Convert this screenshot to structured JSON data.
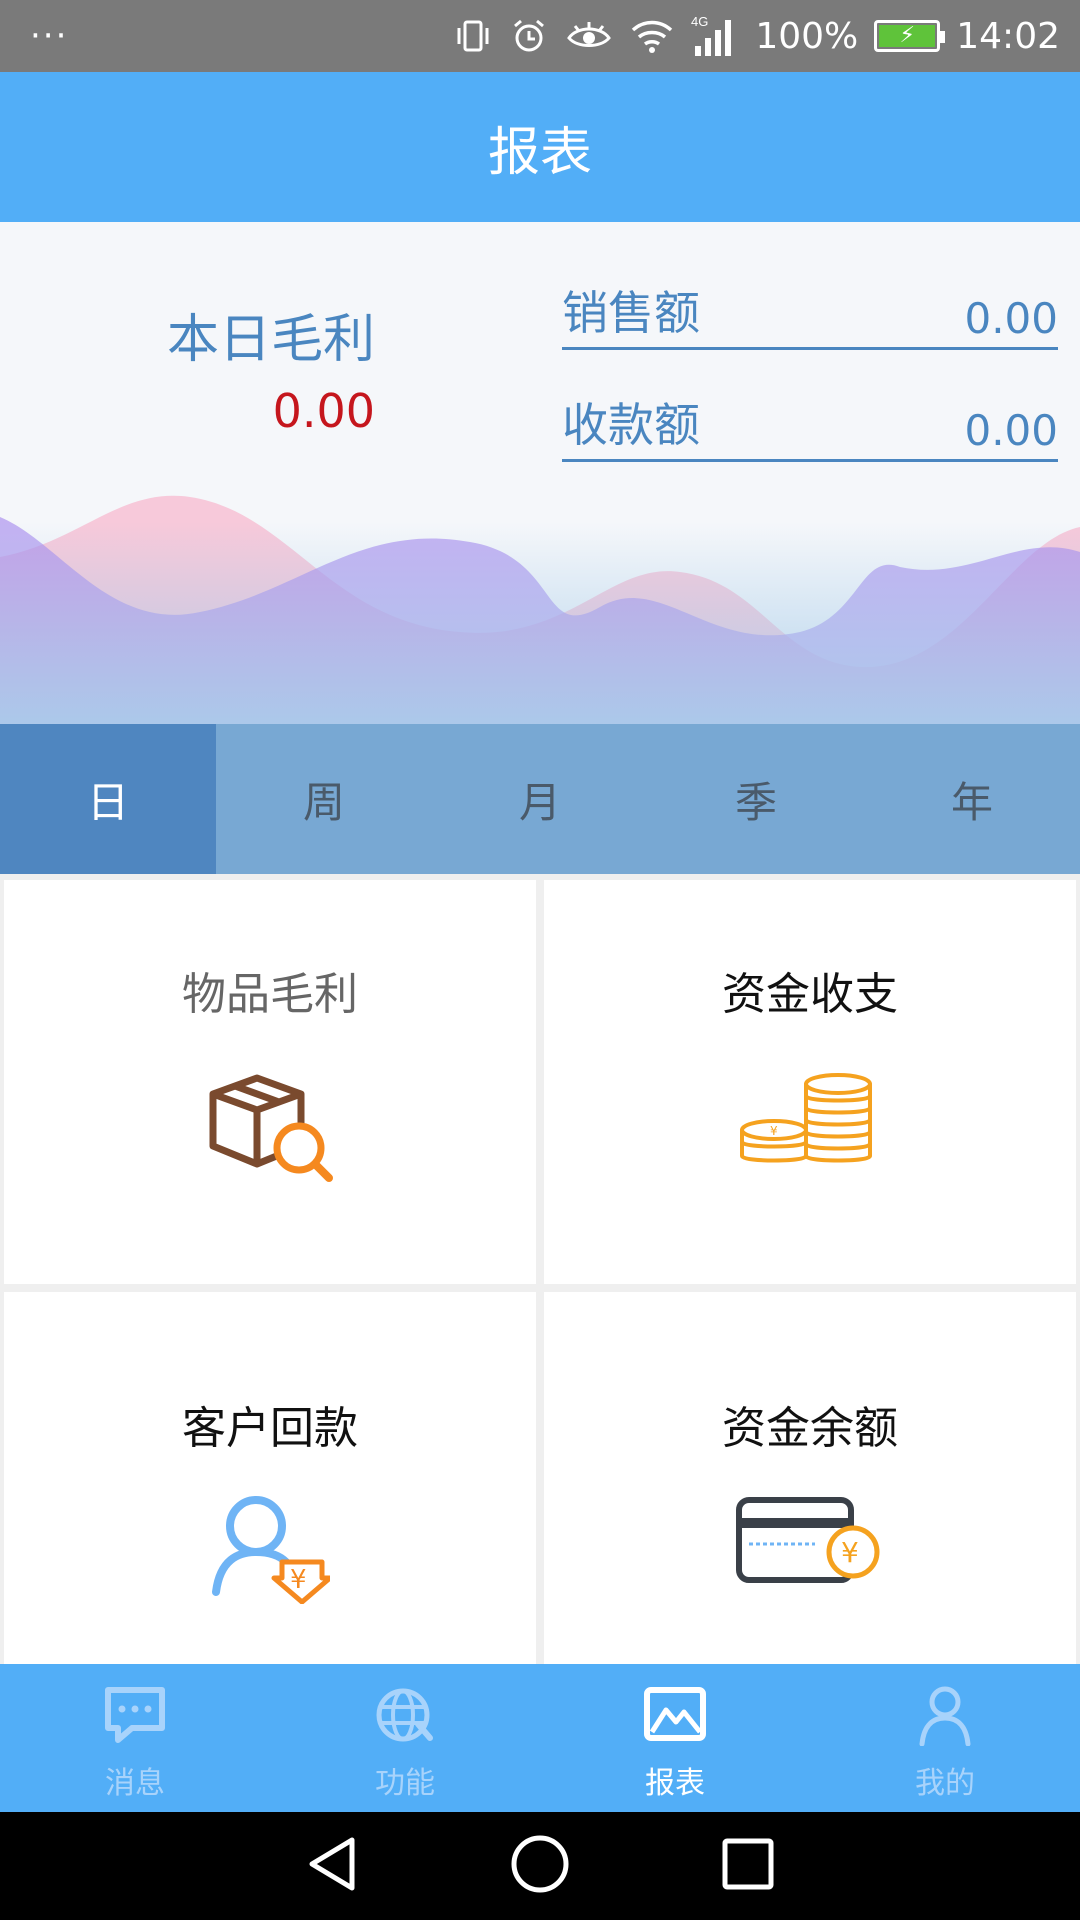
{
  "status_bar": {
    "menu_dots": "···",
    "network": "4G",
    "battery_text": "100%",
    "time": "14:02",
    "battery_color": "#5fc33a",
    "icons": [
      "vibrate-icon",
      "alarm-icon",
      "eye-icon",
      "wifi-icon",
      "signal-icon",
      "battery-icon"
    ]
  },
  "header": {
    "title": "报表",
    "bg_color": "#52aef7"
  },
  "summary": {
    "day_profit_label": "本日毛利",
    "day_profit_value": "0.00",
    "sales_label": "销售额",
    "sales_value": "0.00",
    "receipts_label": "收款额",
    "receipts_value": "0.00",
    "profit_value_color": "#c5161d",
    "label_color": "#4a86c0"
  },
  "period_tabs": {
    "items": [
      "日",
      "周",
      "月",
      "季",
      "年"
    ],
    "active_index": 0
  },
  "report_cards": [
    {
      "label": "物品毛利",
      "icon": "box-search-icon"
    },
    {
      "label": "资金收支",
      "icon": "coins-icon"
    },
    {
      "label": "客户回款",
      "icon": "user-return-icon"
    },
    {
      "label": "资金余额",
      "icon": "card-balance-icon"
    }
  ],
  "bottom_nav": {
    "items": [
      {
        "label": "消息",
        "icon": "message-icon"
      },
      {
        "label": "功能",
        "icon": "globe-icon"
      },
      {
        "label": "报表",
        "icon": "image-chart-icon"
      },
      {
        "label": "我的",
        "icon": "person-icon"
      }
    ],
    "active_index": 2
  },
  "system_nav": {
    "icons": [
      "back-icon",
      "home-icon",
      "recents-icon"
    ]
  }
}
